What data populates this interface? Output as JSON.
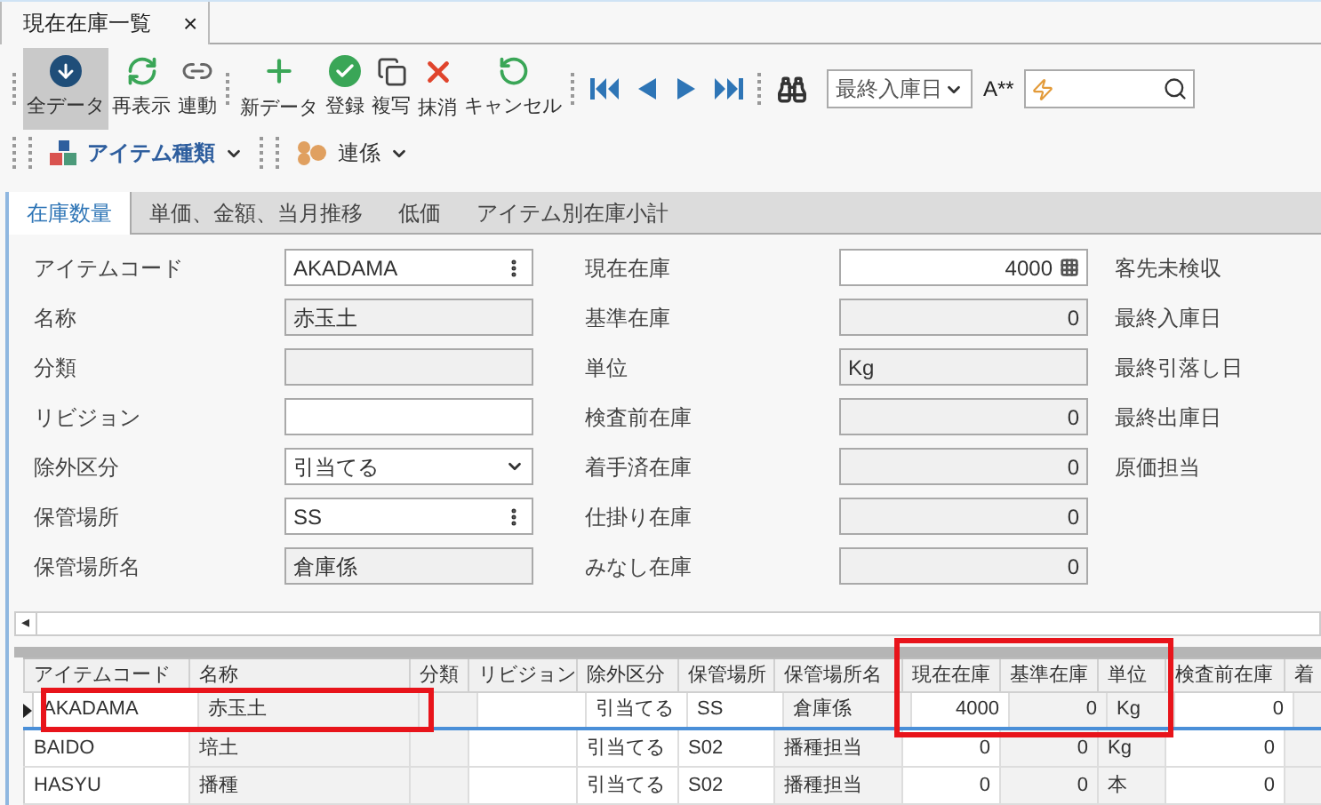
{
  "document_tab": {
    "title": "現在在庫一覧",
    "close": "×"
  },
  "toolbar": [
    {
      "kind": "button",
      "label": "全データ",
      "selected": true
    },
    {
      "kind": "button",
      "label": "再表示",
      "selected": false
    },
    {
      "kind": "button",
      "label": "連動",
      "selected": false
    },
    {
      "kind": "sep"
    },
    {
      "kind": "button",
      "label": "新データ",
      "selected": false
    },
    {
      "kind": "button",
      "label": "登録",
      "selected": false
    },
    {
      "kind": "button",
      "label": "複写",
      "selected": false
    },
    {
      "kind": "button",
      "label": "抹消",
      "selected": false
    },
    {
      "kind": "button",
      "label": "キャンセル",
      "selected": false
    },
    {
      "kind": "sep"
    },
    {
      "kind": "nav"
    },
    {
      "kind": "nav"
    },
    {
      "kind": "nav"
    },
    {
      "kind": "nav"
    },
    {
      "kind": "sep"
    },
    {
      "kind": "nav"
    },
    {
      "kind": "select",
      "value": "最終入庫日"
    },
    {
      "kind": "text",
      "label": "A**"
    },
    {
      "kind": "search"
    }
  ],
  "toolbar2": [
    {
      "label": "アイテム種類",
      "bold": true
    },
    {
      "label": "連係",
      "bold": false
    }
  ],
  "tabs": [
    {
      "label": "在庫数量",
      "selected": true
    },
    {
      "label": "単価、金額、当月推移",
      "selected": false
    },
    {
      "label": "低価",
      "selected": false
    },
    {
      "label": "アイテム別在庫小計",
      "selected": false
    }
  ],
  "form": {
    "left": [
      {
        "label": "アイテムコード",
        "kind": "lookup",
        "value": "AKADAMA"
      },
      {
        "label": "名称",
        "kind": "readonly",
        "value": "赤玉土"
      },
      {
        "label": "分類",
        "kind": "readonly"
      },
      {
        "label": "リビジョン",
        "kind": "input"
      },
      {
        "label": "除外区分",
        "kind": "dropdown",
        "value": "引当てる"
      },
      {
        "label": "保管場所",
        "kind": "lookup",
        "value": "SS"
      },
      {
        "label": "保管場所名",
        "kind": "readonly",
        "value": "倉庫係"
      }
    ],
    "middle": [
      {
        "label": "現在在庫",
        "kind": "spin",
        "value": "4000"
      },
      {
        "label": "基準在庫",
        "kind": "readonly-number",
        "value": "0"
      },
      {
        "label": "単位",
        "kind": "readonly",
        "value": "Kg"
      },
      {
        "label": "検査前在庫",
        "kind": "readonly-number",
        "value": "0"
      },
      {
        "label": "着手済在庫",
        "kind": "readonly-number",
        "value": "0"
      },
      {
        "label": "仕掛り在庫",
        "kind": "readonly-number",
        "value": "0"
      },
      {
        "label": "みなし在庫",
        "kind": "readonly-number",
        "value": "0"
      }
    ],
    "right": [
      "客先未検収",
      "最終入庫日",
      "最終引落し日",
      "最終出庫日",
      "原価担当"
    ]
  },
  "scroll_left": "◂",
  "grid": {
    "columns": [
      {
        "label": "アイテムコード",
        "numeric": false,
        "shaded": false
      },
      {
        "label": "名称",
        "numeric": false,
        "shaded": true
      },
      {
        "label": "分類",
        "numeric": false,
        "shaded": true
      },
      {
        "label": "リビジョン",
        "numeric": false,
        "shaded": false
      },
      {
        "label": "除外区分",
        "numeric": false,
        "shaded": false
      },
      {
        "label": "保管場所",
        "numeric": false,
        "shaded": false
      },
      {
        "label": "保管場所名",
        "numeric": false,
        "shaded": true
      },
      {
        "label": "現在在庫",
        "numeric": true,
        "shaded": false,
        "framed": true
      },
      {
        "label": "基準在庫",
        "numeric": true,
        "shaded": true,
        "framed": true
      },
      {
        "label": "単位",
        "numeric": false,
        "shaded": true,
        "framed": true
      },
      {
        "label": "検査前在庫",
        "numeric": true,
        "shaded": false
      },
      {
        "label": "着",
        "numeric": false,
        "shaded": true
      }
    ],
    "rows": [
      {
        "selected": true,
        "framed": true,
        "cells": [
          "AKADAMA",
          "赤玉土",
          "",
          "",
          "引当てる",
          "SS",
          "倉庫係",
          "4000",
          "0",
          "Kg",
          "0",
          ""
        ]
      },
      {
        "selected": false,
        "framed": false,
        "cells": [
          "BAIDO",
          "培土",
          "",
          "",
          "引当てる",
          "S02",
          "播種担当",
          "0",
          "0",
          "Kg",
          "0",
          ""
        ]
      },
      {
        "selected": false,
        "framed": false,
        "cells": [
          "HASYU",
          "播種",
          "",
          "",
          "引当てる",
          "S02",
          "播種担当",
          "0",
          "0",
          "本",
          "0",
          ""
        ]
      }
    ]
  }
}
